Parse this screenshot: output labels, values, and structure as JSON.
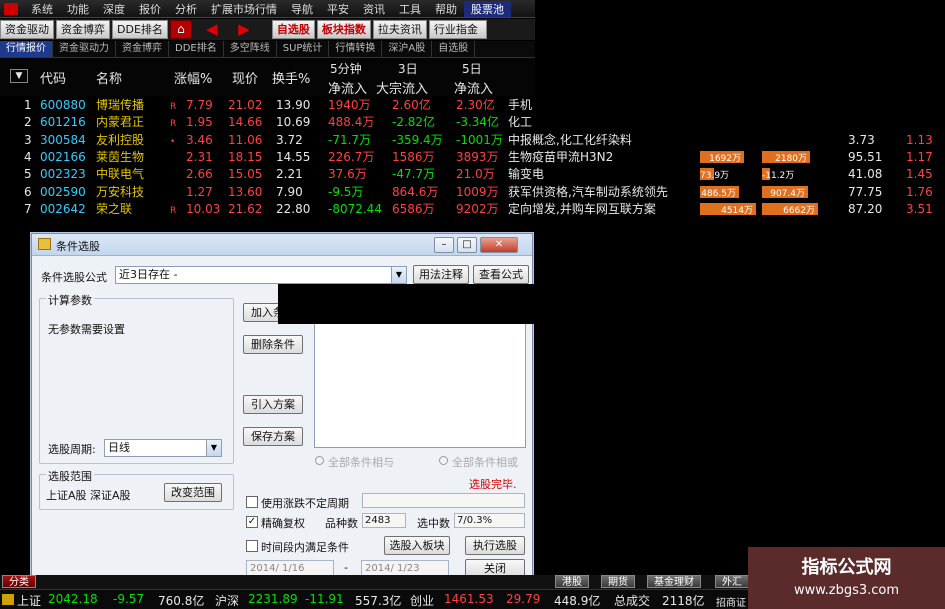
{
  "menubar": {
    "items": [
      "系统",
      "功能",
      "深度",
      "报价",
      "分析",
      "扩展市场行情",
      "导航",
      "平安",
      "资讯",
      "工具",
      "帮助",
      "股票池"
    ]
  },
  "toolbar": {
    "buttons": [
      "资金驱动",
      "资金博弈",
      "DDE排名"
    ],
    "zixuan": "自选股",
    "bankuai": "板块指数",
    "btn3": "拉夫资讯",
    "btn4": "行业指金"
  },
  "tabs": [
    "行情报价",
    "资金驱动力",
    "资金博弈",
    "DDE排名",
    "多空阵线",
    "SUP统计",
    "行情转换",
    "深沪A股",
    "自选股"
  ],
  "table": {
    "headers": {
      "code": "代码",
      "name": "名称",
      "change": "涨幅%",
      "price": "现价",
      "turnover": "换手%",
      "flow5m_top": "5分钟",
      "flow5m_bot": "净流入",
      "big3_top": "3日",
      "big3_bot": "大宗流入",
      "flow5d_top": "5日",
      "flow5d_bot": "净流入"
    },
    "rows": [
      {
        "idx": "1",
        "code": "600880",
        "name": "博瑞传播",
        "flag": "R",
        "change": "7.79",
        "price": "21.02",
        "turnover": "13.90",
        "flow5m": "1940万",
        "big3": "2.60亿",
        "flow5d": "2.30亿",
        "concept": "手机",
        "bar1": "",
        "bar1_pct": 0,
        "bar2": "",
        "bar2_pct": 0,
        "val1": "",
        "val2": ""
      },
      {
        "idx": "2",
        "code": "601216",
        "name": "内蒙君正",
        "flag": "R",
        "change": "1.95",
        "price": "14.66",
        "turnover": "10.69",
        "flow5m": "488.4万",
        "big3": "-2.82亿",
        "flow5d": "-3.34亿",
        "concept": "化工",
        "bar1": "",
        "bar1_pct": 0,
        "bar2": "",
        "bar2_pct": 0,
        "val1": "",
        "val2": ""
      },
      {
        "idx": "3",
        "code": "300584",
        "name": "友利控股",
        "flag": "•",
        "change": "3.46",
        "price": "11.06",
        "turnover": "3.72",
        "flow5m": "-71.7万",
        "big3": "-359.4万",
        "flow5d": "-1001万",
        "concept": "中报概念,化工化纤染料",
        "bar1": "",
        "bar1_pct": 0,
        "bar2": "",
        "bar2_pct": 0,
        "val1": "3.73",
        "val2": "1.13"
      },
      {
        "idx": "4",
        "code": "002166",
        "name": "莱茵生物",
        "flag": "",
        "change": "2.31",
        "price": "18.15",
        "turnover": "14.55",
        "flow5m": "226.7万",
        "big3": "1586万",
        "flow5d": "3893万",
        "concept": "生物疫苗甲流H3N2",
        "bar1": "1692万",
        "bar1_pct": 0.78,
        "bar2": "2180万",
        "bar2_pct": 0.85,
        "val1": "95.51",
        "val2": "1.17"
      },
      {
        "idx": "5",
        "code": "002323",
        "name": "中联电气",
        "flag": "",
        "change": "2.66",
        "price": "15.05",
        "turnover": "2.21",
        "flow5m": "37.6万",
        "big3": "-47.7万",
        "flow5d": "21.0万",
        "concept": "输变电",
        "bar1": "73.9万",
        "bar1_pct": 0.25,
        "bar2": "-11.2万",
        "bar2_pct": 0.02,
        "val1": "41.08",
        "val2": "1.45"
      },
      {
        "idx": "6",
        "code": "002590",
        "name": "万安科技",
        "flag": "",
        "change": "1.27",
        "price": "13.60",
        "turnover": "7.90",
        "flow5m": "-9.5万",
        "big3": "864.6万",
        "flow5d": "1009万",
        "concept": "获军供资格,汽车制动系统领先",
        "bar1": "486.5万",
        "bar1_pct": 0.7,
        "bar2": "907.4万",
        "bar2_pct": 0.82,
        "val1": "77.75",
        "val2": "1.76"
      },
      {
        "idx": "7",
        "code": "002642",
        "name": "荣之联",
        "flag": "R",
        "change": "10.03",
        "price": "21.62",
        "turnover": "22.80",
        "flow5m": "-8072.44",
        "big3": "6586万",
        "flow5d": "9202万",
        "concept": "定向增发,并购车网互联方案",
        "bar1": "4514万",
        "bar1_pct": 1.0,
        "bar2": "6662万",
        "bar2_pct": 1.0,
        "val1": "87.20",
        "val2": "3.51"
      }
    ]
  },
  "dialog": {
    "title": "条件选股",
    "formula_label": "条件选股公式",
    "formula_value": "近3日存在 -",
    "usage_btn": "用法注释",
    "view_btn": "查看公式",
    "params_group": "计算参数",
    "params_text": "无参数需要设置",
    "add_btn": "加入条件",
    "delete_btn": "删除条件",
    "import_btn": "引入方案",
    "save_btn": "保存方案",
    "period_label": "选股周期:",
    "period_value": "日线",
    "range_group": "选股范围",
    "range_text": "上证A股  深证A股",
    "change_range_btn": "改变范围",
    "radio_and": "全部条件相与",
    "radio_or": "全部条件相或",
    "done_text": "选股完毕.",
    "chk_unfixed": "使用涨跌不定周期",
    "chk_precise": "精确复权",
    "count_label": "品种数",
    "count_value": "2483",
    "selected_label": "选中数",
    "selected_value": "7/0.3%",
    "chk_period": "时间段内满足条件",
    "to_block_btn": "选股入板块",
    "execute_btn": "执行选股",
    "close_btn": "关闭",
    "date_from": "2014/ 1/16",
    "date_sep": "-",
    "date_to": "2014/ 1/23"
  },
  "subtabs": [
    "分类",
    "港股",
    "期货",
    "基金理财",
    "外汇"
  ],
  "status": {
    "sh_label": "上证",
    "sh_idx": "2042.18",
    "sh_chg": "-9.57",
    "sh_amt": "760.8亿",
    "hs_label": "沪深",
    "hs_idx": "2231.89",
    "hs_chg": "-11.91",
    "hs_amt": "557.3亿",
    "cy_label": "创业",
    "cy_idx": "1461.53",
    "cy_chg": "29.79",
    "cy_amt": "448.9亿",
    "total_label": "总成交",
    "total_amt": "2118亿",
    "broker": "招商证"
  },
  "watermark": {
    "line1": "指标公式网",
    "line2": "www.zbgs3.com"
  }
}
